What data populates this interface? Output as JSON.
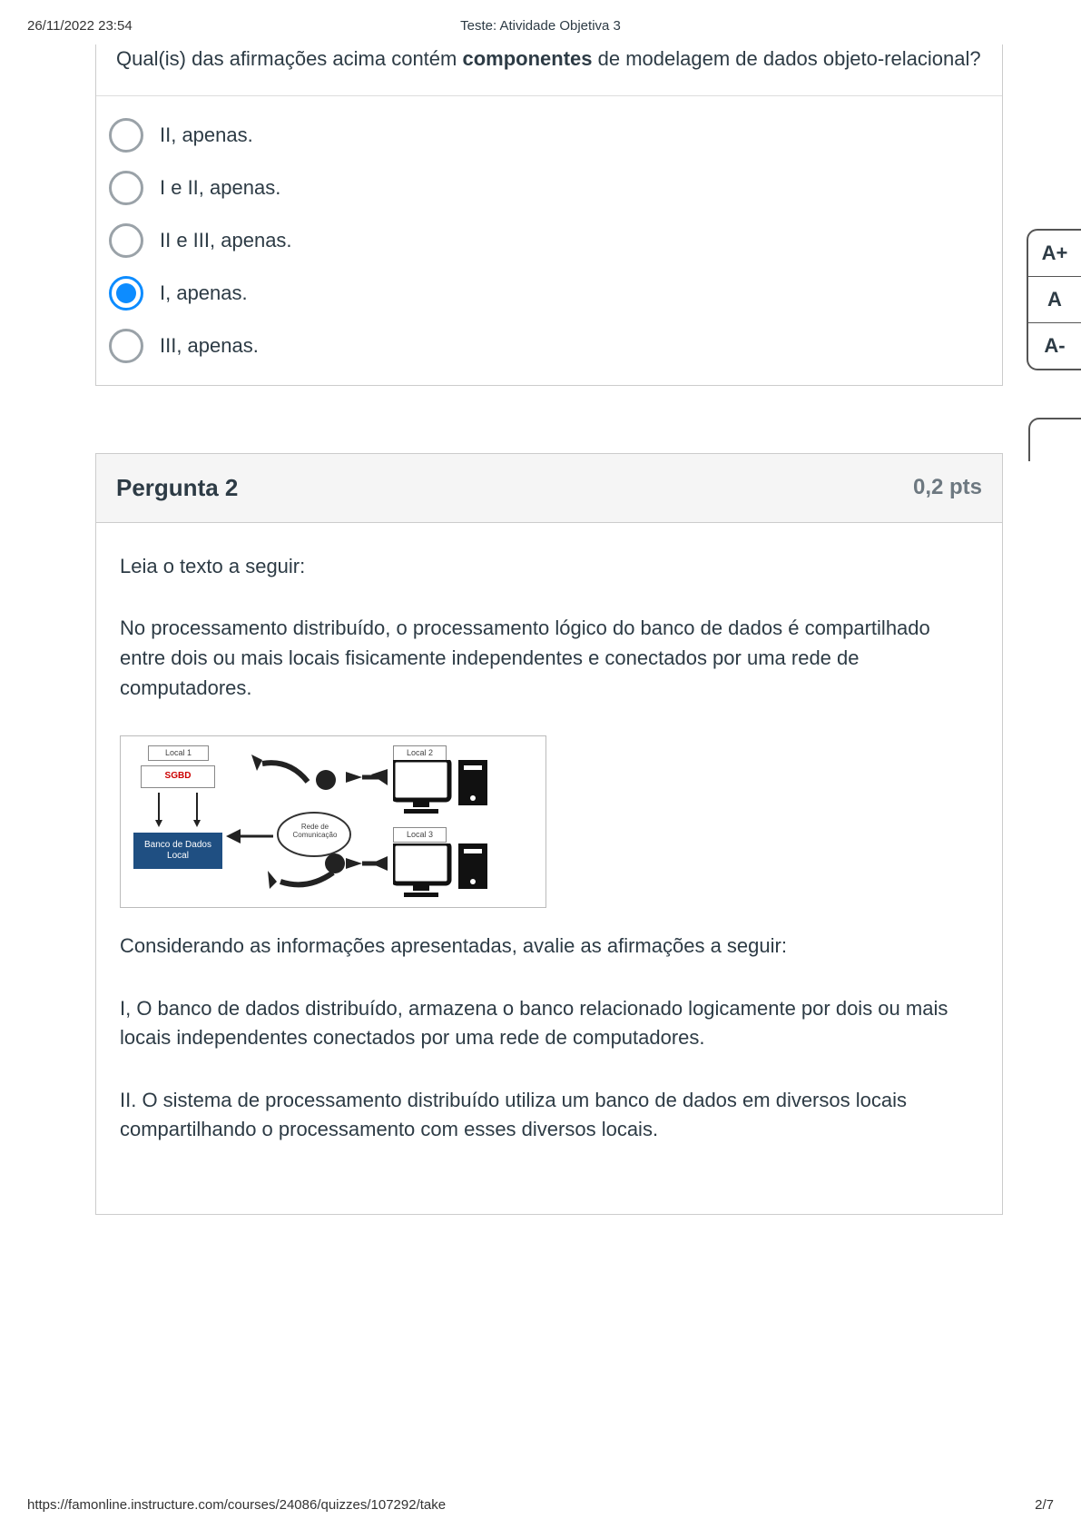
{
  "header": {
    "datetime": "26/11/2022 23:54",
    "title": "Teste: Atividade Objetiva 3"
  },
  "question1": {
    "stem_pre": "Qual(is) das afirmações acima contém ",
    "stem_bold": "componentes",
    "stem_post": " de modelagem de dados objeto-relacional?",
    "options": [
      {
        "label": "II, apenas.",
        "selected": false
      },
      {
        "label": "I e II, apenas.",
        "selected": false
      },
      {
        "label": "II e III, apenas.",
        "selected": false
      },
      {
        "label": "I, apenas.",
        "selected": true
      },
      {
        "label": "III, apenas.",
        "selected": false
      }
    ]
  },
  "question2": {
    "title": "Pergunta 2",
    "points": "0,2 pts",
    "p_intro": "Leia o texto a seguir:",
    "p_body": "No processamento distribuído, o processamento lógico do banco de dados é compartilhado entre dois ou mais locais fisicamente independentes e conectados por uma rede de computadores.",
    "p_consider": "Considerando as informações apresentadas, avalie as afirmações a seguir:",
    "stmt1": "I, O banco de dados distribuído, armazena o banco relacionado logicamente por dois ou mais locais independentes conectados por uma rede de computadores.",
    "stmt2": "II. O sistema de processamento distribuído utiliza um banco de dados em diversos locais compartilhando o processamento com esses diversos locais.",
    "diagram": {
      "local1": "Local 1",
      "local2": "Local 2",
      "local3": "Local 3",
      "sgbd": "SGBD",
      "rede": "Rede de Comunicação",
      "banco": "Banco de Dados Local"
    }
  },
  "font_widget": {
    "increase": "A+",
    "normal": "A",
    "decrease": "A-"
  },
  "footer": {
    "url": "https://famonline.instructure.com/courses/24086/quizzes/107292/take",
    "page": "2/7"
  }
}
